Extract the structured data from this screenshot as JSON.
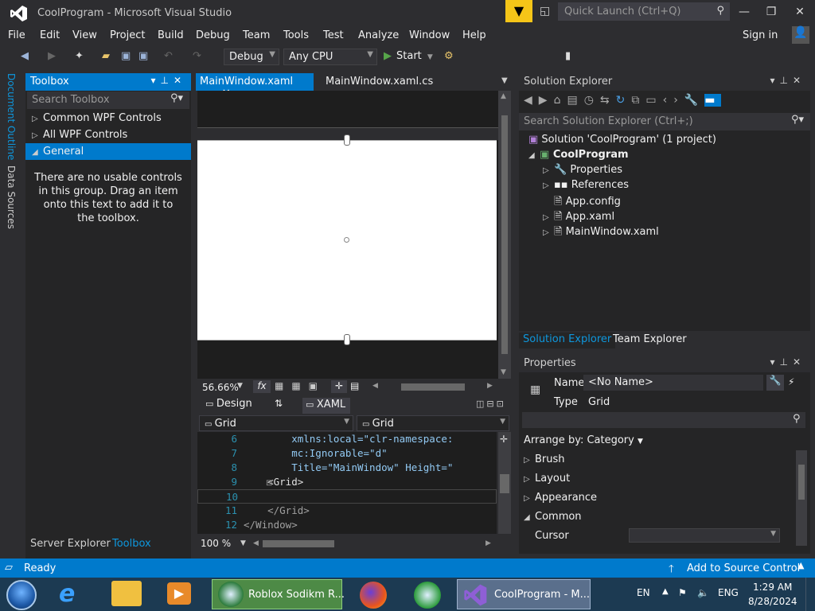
{
  "app": {
    "title": "CoolProgram - Microsoft Visual Studio",
    "quick_launch_placeholder": "Quick Launch (Ctrl+Q)",
    "accent": "#007acc"
  },
  "menu": {
    "items": [
      "File",
      "Edit",
      "View",
      "Project",
      "Build",
      "Debug",
      "Team",
      "Tools",
      "Test",
      "Analyze",
      "Window",
      "Help"
    ],
    "sign_in": "Sign in"
  },
  "toolbar": {
    "config": "Debug",
    "platform": "Any CPU",
    "start": "Start"
  },
  "left_tabs": [
    "Document Outline",
    "Data Sources"
  ],
  "toolbox": {
    "title": "Toolbox",
    "search_placeholder": "Search Toolbox",
    "groups": [
      "Common WPF Controls",
      "All WPF Controls",
      "General"
    ],
    "empty_message": "There are no usable controls in this group. Drag an item onto this text to add it to the toolbox.",
    "bottom_tabs": [
      "Server Explorer",
      "Toolbox"
    ]
  },
  "editor": {
    "tabs": [
      "MainWindow.xaml",
      "MainWindow.xaml.cs"
    ],
    "zoom": "56.66%",
    "fx": "fx",
    "design_tab": "Design",
    "xaml_tab": "XAML",
    "crumb_left": "Grid",
    "crumb_right": "Grid",
    "code_zoom": "100 %",
    "lines": [
      {
        "num": "6",
        "text": "        xmlns:local=\"clr-namespace:"
      },
      {
        "num": "7",
        "text": "        mc:Ignorable=\"d\""
      },
      {
        "num": "8",
        "text": "        Title=\"MainWindow\" Height=\""
      },
      {
        "num": "9",
        "text": "    <Grid>"
      },
      {
        "num": "10",
        "text": ""
      },
      {
        "num": "11",
        "text": "    </Grid>"
      },
      {
        "num": "12",
        "text": "</Window>"
      }
    ]
  },
  "solution_explorer": {
    "title": "Solution Explorer",
    "search_placeholder": "Search Solution Explorer (Ctrl+;)",
    "solution": "Solution 'CoolProgram' (1 project)",
    "project": "CoolProgram",
    "items": [
      "Properties",
      "References",
      "App.config",
      "App.xaml",
      "MainWindow.xaml"
    ],
    "tabs": [
      "Solution Explorer",
      "Team Explorer"
    ]
  },
  "properties": {
    "title": "Properties",
    "name_label": "Name",
    "name_value": "<No Name>",
    "type_label": "Type",
    "type_value": "Grid",
    "arrange_by": "Arrange by: Category",
    "categories": [
      "Brush",
      "Layout",
      "Appearance",
      "Common"
    ],
    "cursor_label": "Cursor"
  },
  "status": {
    "text": "Ready",
    "source_control": "Add to Source Control"
  },
  "taskbar": {
    "roblox": "Roblox Sodikm R...",
    "vs": "CoolProgram - M...",
    "lang": "EN",
    "input": "ENG",
    "time": "1:29 AM",
    "date": "8/28/2024"
  }
}
